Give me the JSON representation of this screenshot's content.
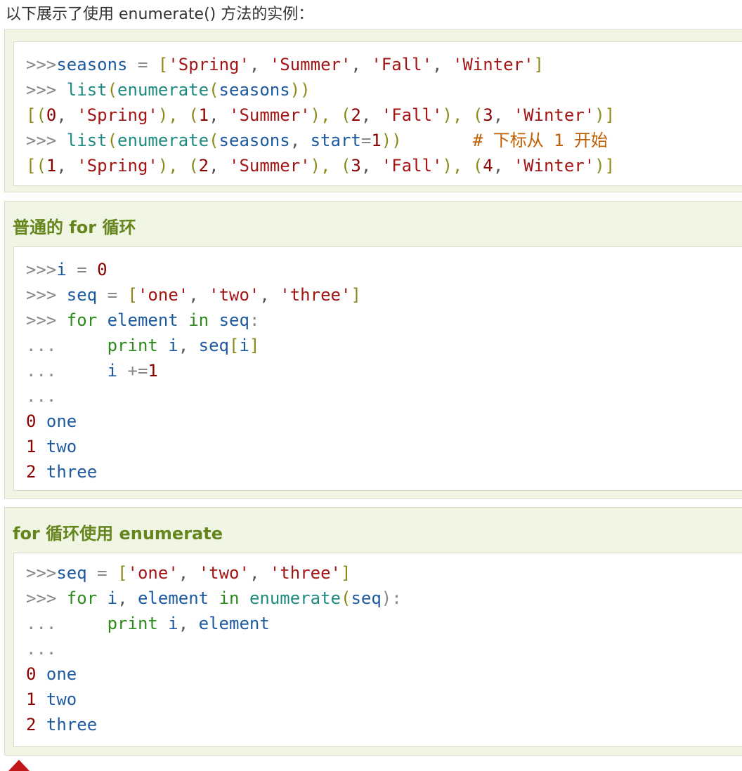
{
  "intro": {
    "text": "以下展示了使用 enumerate() 方法的实例："
  },
  "examples": {
    "one": {
      "lines": [
        [
          {
            "t": ">>>",
            "c": "p"
          },
          {
            "t": "seasons",
            "c": "n"
          },
          {
            "t": " = ",
            "c": "o"
          },
          {
            "t": "[",
            "c": "b"
          },
          {
            "t": "'Spring'",
            "c": "s"
          },
          {
            "t": ", ",
            "c": "cm"
          },
          {
            "t": "'Summer'",
            "c": "s"
          },
          {
            "t": ", ",
            "c": "cm"
          },
          {
            "t": "'Fall'",
            "c": "s"
          },
          {
            "t": ", ",
            "c": "cm"
          },
          {
            "t": "'Winter'",
            "c": "s"
          },
          {
            "t": "]",
            "c": "b"
          }
        ],
        [
          {
            "t": ">>> ",
            "c": "p"
          },
          {
            "t": "list",
            "c": "f"
          },
          {
            "t": "(",
            "c": "b"
          },
          {
            "t": "enumerate",
            "c": "f"
          },
          {
            "t": "(",
            "c": "b"
          },
          {
            "t": "seasons",
            "c": "n"
          },
          {
            "t": "))",
            "c": "b"
          }
        ],
        [
          {
            "t": "[(",
            "c": "b"
          },
          {
            "t": "0",
            "c": "num"
          },
          {
            "t": ", ",
            "c": "cm"
          },
          {
            "t": "'Spring'",
            "c": "s"
          },
          {
            "t": "), (",
            "c": "b"
          },
          {
            "t": "1",
            "c": "num"
          },
          {
            "t": ", ",
            "c": "cm"
          },
          {
            "t": "'Summer'",
            "c": "s"
          },
          {
            "t": "), (",
            "c": "b"
          },
          {
            "t": "2",
            "c": "num"
          },
          {
            "t": ", ",
            "c": "cm"
          },
          {
            "t": "'Fall'",
            "c": "s"
          },
          {
            "t": "), (",
            "c": "b"
          },
          {
            "t": "3",
            "c": "num"
          },
          {
            "t": ", ",
            "c": "cm"
          },
          {
            "t": "'Winter'",
            "c": "s"
          },
          {
            "t": ")]",
            "c": "b"
          }
        ],
        [
          {
            "t": ">>> ",
            "c": "p"
          },
          {
            "t": "list",
            "c": "f"
          },
          {
            "t": "(",
            "c": "b"
          },
          {
            "t": "enumerate",
            "c": "f"
          },
          {
            "t": "(",
            "c": "b"
          },
          {
            "t": "seasons",
            "c": "n"
          },
          {
            "t": ", ",
            "c": "cm"
          },
          {
            "t": "start",
            "c": "n"
          },
          {
            "t": "=",
            "c": "o"
          },
          {
            "t": "1",
            "c": "num"
          },
          {
            "t": "))",
            "c": "b"
          },
          {
            "t": "       # 下标从 1 开始",
            "c": "c"
          }
        ],
        [
          {
            "t": "[(",
            "c": "b"
          },
          {
            "t": "1",
            "c": "num"
          },
          {
            "t": ", ",
            "c": "cm"
          },
          {
            "t": "'Spring'",
            "c": "s"
          },
          {
            "t": "), (",
            "c": "b"
          },
          {
            "t": "2",
            "c": "num"
          },
          {
            "t": ", ",
            "c": "cm"
          },
          {
            "t": "'Summer'",
            "c": "s"
          },
          {
            "t": "), (",
            "c": "b"
          },
          {
            "t": "3",
            "c": "num"
          },
          {
            "t": ", ",
            "c": "cm"
          },
          {
            "t": "'Fall'",
            "c": "s"
          },
          {
            "t": "), (",
            "c": "b"
          },
          {
            "t": "4",
            "c": "num"
          },
          {
            "t": ", ",
            "c": "cm"
          },
          {
            "t": "'Winter'",
            "c": "s"
          },
          {
            "t": ")]",
            "c": "b"
          }
        ]
      ]
    },
    "two": {
      "title": "普通的 for 循环",
      "lines": [
        [
          {
            "t": ">>>",
            "c": "p"
          },
          {
            "t": "i",
            "c": "n"
          },
          {
            "t": " = ",
            "c": "o"
          },
          {
            "t": "0",
            "c": "num"
          }
        ],
        [
          {
            "t": ">>> ",
            "c": "p"
          },
          {
            "t": "seq",
            "c": "n"
          },
          {
            "t": " = ",
            "c": "o"
          },
          {
            "t": "[",
            "c": "b"
          },
          {
            "t": "'one'",
            "c": "s"
          },
          {
            "t": ", ",
            "c": "cm"
          },
          {
            "t": "'two'",
            "c": "s"
          },
          {
            "t": ", ",
            "c": "cm"
          },
          {
            "t": "'three'",
            "c": "s"
          },
          {
            "t": "]",
            "c": "b"
          }
        ],
        [
          {
            "t": ">>> ",
            "c": "p"
          },
          {
            "t": "for",
            "c": "k"
          },
          {
            "t": " ",
            "c": "o"
          },
          {
            "t": "element",
            "c": "n"
          },
          {
            "t": " ",
            "c": "o"
          },
          {
            "t": "in",
            "c": "k"
          },
          {
            "t": " ",
            "c": "o"
          },
          {
            "t": "seq",
            "c": "n"
          },
          {
            "t": ":",
            "c": "o"
          }
        ],
        [
          {
            "t": "...     ",
            "c": "p"
          },
          {
            "t": "print",
            "c": "k"
          },
          {
            "t": " ",
            "c": "o"
          },
          {
            "t": "i",
            "c": "n"
          },
          {
            "t": ", ",
            "c": "cm"
          },
          {
            "t": "seq",
            "c": "n"
          },
          {
            "t": "[",
            "c": "b"
          },
          {
            "t": "i",
            "c": "n"
          },
          {
            "t": "]",
            "c": "b"
          }
        ],
        [
          {
            "t": "...     ",
            "c": "p"
          },
          {
            "t": "i",
            "c": "n"
          },
          {
            "t": " +=",
            "c": "o"
          },
          {
            "t": "1",
            "c": "num"
          }
        ],
        [
          {
            "t": "...",
            "c": "p"
          }
        ],
        [
          {
            "t": "0",
            "c": "num"
          },
          {
            "t": " ",
            "c": "o"
          },
          {
            "t": "one",
            "c": "n"
          }
        ],
        [
          {
            "t": "1",
            "c": "num"
          },
          {
            "t": " ",
            "c": "o"
          },
          {
            "t": "two",
            "c": "n"
          }
        ],
        [
          {
            "t": "2",
            "c": "num"
          },
          {
            "t": " ",
            "c": "o"
          },
          {
            "t": "three",
            "c": "n"
          }
        ]
      ]
    },
    "three": {
      "title": "for 循环使用 enumerate",
      "lines": [
        [
          {
            "t": ">>>",
            "c": "p"
          },
          {
            "t": "seq",
            "c": "n"
          },
          {
            "t": " = ",
            "c": "o"
          },
          {
            "t": "[",
            "c": "b"
          },
          {
            "t": "'one'",
            "c": "s"
          },
          {
            "t": ", ",
            "c": "cm"
          },
          {
            "t": "'two'",
            "c": "s"
          },
          {
            "t": ", ",
            "c": "cm"
          },
          {
            "t": "'three'",
            "c": "s"
          },
          {
            "t": "]",
            "c": "b"
          }
        ],
        [
          {
            "t": ">>> ",
            "c": "p"
          },
          {
            "t": "for",
            "c": "k"
          },
          {
            "t": " ",
            "c": "o"
          },
          {
            "t": "i",
            "c": "n"
          },
          {
            "t": ", ",
            "c": "cm"
          },
          {
            "t": "element",
            "c": "n"
          },
          {
            "t": " ",
            "c": "o"
          },
          {
            "t": "in",
            "c": "k"
          },
          {
            "t": " ",
            "c": "o"
          },
          {
            "t": "enumerate",
            "c": "f"
          },
          {
            "t": "(",
            "c": "b"
          },
          {
            "t": "seq",
            "c": "n"
          },
          {
            "t": "):",
            "c": "o"
          }
        ],
        [
          {
            "t": "...     ",
            "c": "p"
          },
          {
            "t": "print",
            "c": "k"
          },
          {
            "t": " ",
            "c": "o"
          },
          {
            "t": "i",
            "c": "n"
          },
          {
            "t": ", ",
            "c": "cm"
          },
          {
            "t": "element",
            "c": "n"
          }
        ],
        [
          {
            "t": "...",
            "c": "p"
          }
        ],
        [
          {
            "t": "0",
            "c": "num"
          },
          {
            "t": " ",
            "c": "o"
          },
          {
            "t": "one",
            "c": "n"
          }
        ],
        [
          {
            "t": "1",
            "c": "num"
          },
          {
            "t": " ",
            "c": "o"
          },
          {
            "t": "two",
            "c": "n"
          }
        ],
        [
          {
            "t": "2",
            "c": "num"
          },
          {
            "t": " ",
            "c": "o"
          },
          {
            "t": "three",
            "c": "n"
          }
        ]
      ]
    }
  },
  "theme": {
    "title_green": "#64861c",
    "example_bg": "#f1f6e4",
    "icon_red": "#c0171b"
  },
  "icons": {
    "bottom": "red-up-triangle-icon"
  }
}
